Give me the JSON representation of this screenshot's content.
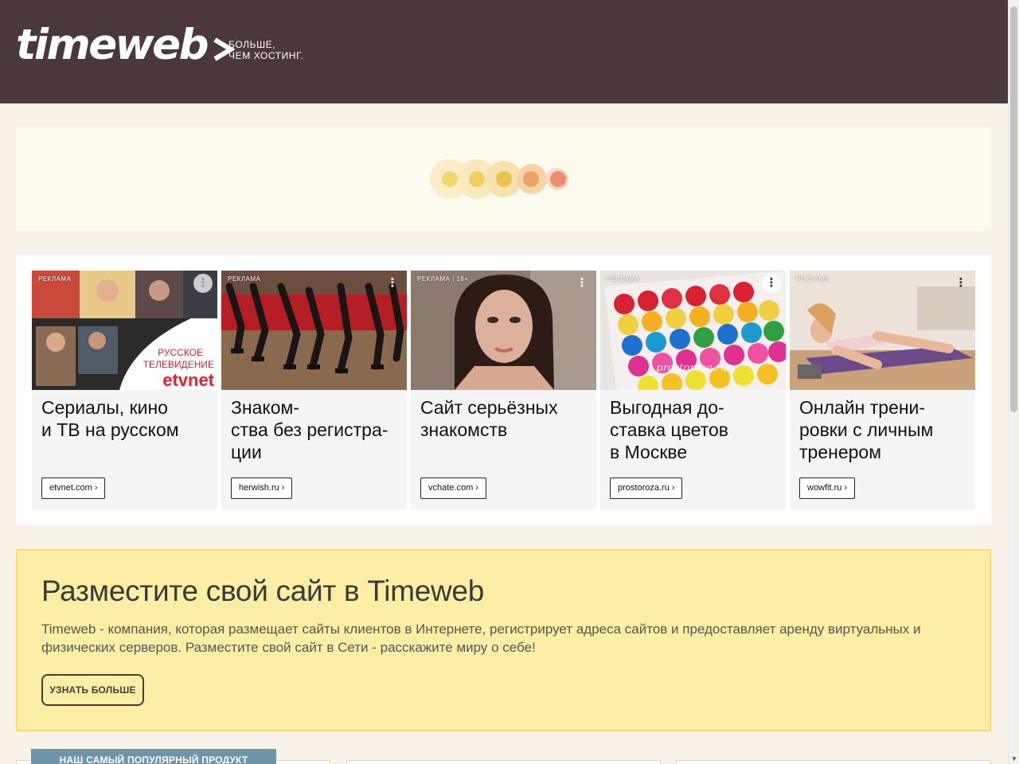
{
  "header": {
    "logo_text": "timeweb",
    "tagline_line1": "БОЛЬШЕ,",
    "tagline_line2": "ЧЕМ ХОСТИНГ."
  },
  "colors": {
    "header_bg": "#4b383a",
    "page_bg": "#f9f2e9",
    "promo_bg": "#fdeea6",
    "promo_border": "#f7d97a",
    "popular_tab": "#6e94a8"
  },
  "loader": {
    "dot_colors": [
      "#f0d86a",
      "#f0cf5e",
      "#ecc24f",
      "#eca261",
      "#ef8c6e"
    ]
  },
  "ads": [
    {
      "label": "РЕКЛАМА",
      "title_line1": "Сериалы, кино",
      "title_line2": "и ТВ на русском",
      "title_line3": "",
      "domain": "etvnet.com",
      "image_text1": "РУССКОЕ",
      "image_text2": "ТЕЛЕВИДЕНИЕ",
      "image_text3": "etvnet"
    },
    {
      "label": "РЕКЛАМА",
      "title_line1": "Знаком-",
      "title_line2": "ства без регистра-",
      "title_line3": "ции",
      "domain": "herwish.ru"
    },
    {
      "label": "РЕКЛАМА | 18+",
      "title_line1": "Сайт серьёзных",
      "title_line2": "знакомств",
      "title_line3": "",
      "domain": "vchate.com"
    },
    {
      "label": "РЕКЛАМА",
      "title_line1": "Выгодная до-",
      "title_line2": "ставка цветов",
      "title_line3": "в Москве",
      "domain": "prostoroza.ru",
      "image_text1": "prostoroza.ru"
    },
    {
      "label": "РЕКЛАМА",
      "title_line1": "Онлайн трени-",
      "title_line2": "ровки с личным",
      "title_line3": "тренером",
      "domain": "wowfit.ru"
    }
  ],
  "promo": {
    "title": "Разместите свой сайт в Timeweb",
    "text": "Timeweb - компания, которая размещает сайты клиентов в Интернете, регистрирует адреса сайтов и предоставляет аренду виртуальных и физических серверов. Разместите свой сайт в Сети - расскажите миру о себе!",
    "button": "УЗНАТЬ БОЛЬШЕ"
  },
  "popular_tab": "НАШ САМЫЙ ПОПУЛЯРНЫЙ ПРОДУКТ"
}
